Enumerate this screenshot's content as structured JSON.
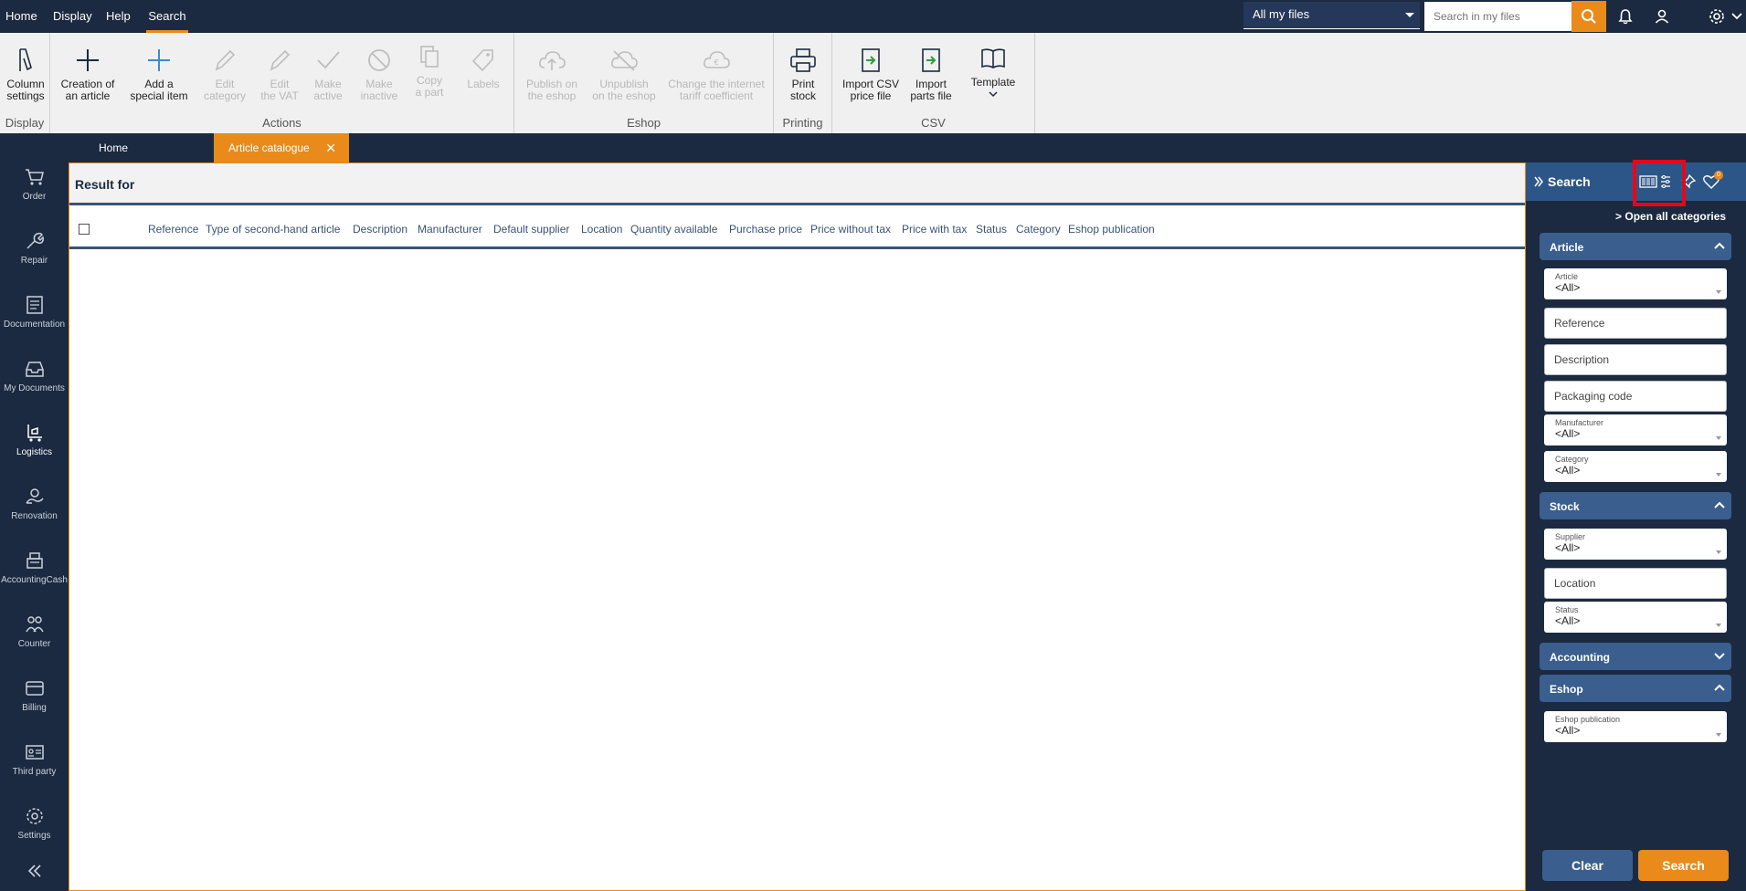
{
  "menu": {
    "items": [
      {
        "label": "Home"
      },
      {
        "label": "Display"
      },
      {
        "label": "Help"
      },
      {
        "label": "Search"
      }
    ]
  },
  "header": {
    "files_filter": "All my files",
    "search_placeholder": "Search in my files",
    "notification_badge": "0"
  },
  "ribbon": {
    "groups": {
      "display": "Display",
      "actions": "Actions",
      "eshop": "Eshop",
      "printing": "Printing",
      "csv": "CSV"
    },
    "buttons": {
      "column_settings": [
        "Column",
        "settings"
      ],
      "creation_article": [
        "Creation of",
        "an article"
      ],
      "add_special": [
        "Add a",
        "special item"
      ],
      "edit_category": [
        "Edit",
        "category"
      ],
      "edit_vat": [
        "Edit",
        "the VAT"
      ],
      "make_active": [
        "Make",
        "active"
      ],
      "make_inactive": [
        "Make",
        "inactive"
      ],
      "copy_part": [
        "Copy",
        "a part"
      ],
      "labels": [
        "Labels",
        ""
      ],
      "publish_eshop": [
        "Publish on",
        "the eshop"
      ],
      "unpublish_eshop": [
        "Unpublish",
        "on the eshop"
      ],
      "change_tariff": [
        "Change the internet",
        "tariff coefficient"
      ],
      "print_stock": [
        "Print",
        "stock"
      ],
      "import_csv_price": [
        "Import CSV",
        "price file"
      ],
      "import_parts": [
        "Import",
        "parts file"
      ],
      "template": [
        "Template",
        ""
      ]
    }
  },
  "nav": {
    "items": [
      {
        "label": "Order"
      },
      {
        "label": "Repair"
      },
      {
        "label": "Documentation"
      },
      {
        "label": "My Documents"
      },
      {
        "label": "Logistics"
      },
      {
        "label": "Renovation"
      },
      {
        "label": "AccountingCash"
      },
      {
        "label": "Counter"
      },
      {
        "label": "Billing"
      },
      {
        "label": "Third party"
      },
      {
        "label": "Settings"
      }
    ]
  },
  "tabs": [
    {
      "label": "Home"
    },
    {
      "label": "Article catalogue"
    }
  ],
  "main": {
    "result_title": "Result for",
    "columns": [
      "Reference",
      "Type of second-hand article",
      "Description",
      "Manufacturer",
      "Default supplier",
      "Location",
      "Quantity available",
      "Purchase price",
      "Price without tax",
      "Price with tax",
      "Status",
      "Category",
      "Eshop publication"
    ]
  },
  "search_panel": {
    "title": "Search",
    "open_all": "Open all categories",
    "sections": {
      "article": "Article",
      "stock": "Stock",
      "accounting": "Accounting",
      "eshop": "Eshop"
    },
    "fields": {
      "article": {
        "label": "Article",
        "value": "<All>"
      },
      "reference": "Reference",
      "description": "Description",
      "packaging": "Packaging code",
      "manufacturer": {
        "label": "Manufacturer",
        "value": "<All>"
      },
      "category": {
        "label": "Category",
        "value": "<All>"
      },
      "supplier": {
        "label": "Supplier",
        "value": "<All>"
      },
      "location": "Location",
      "status": {
        "label": "Status",
        "value": "<All>"
      },
      "eshop_publication": {
        "label": "Eshop publication",
        "value": "<All>"
      }
    },
    "clear": "Clear",
    "search": "Search"
  },
  "colors": {
    "navy": "#1b2a40",
    "accent": "#e98a1a",
    "section": "#3a5e8e",
    "highlight": "#e8061a"
  }
}
